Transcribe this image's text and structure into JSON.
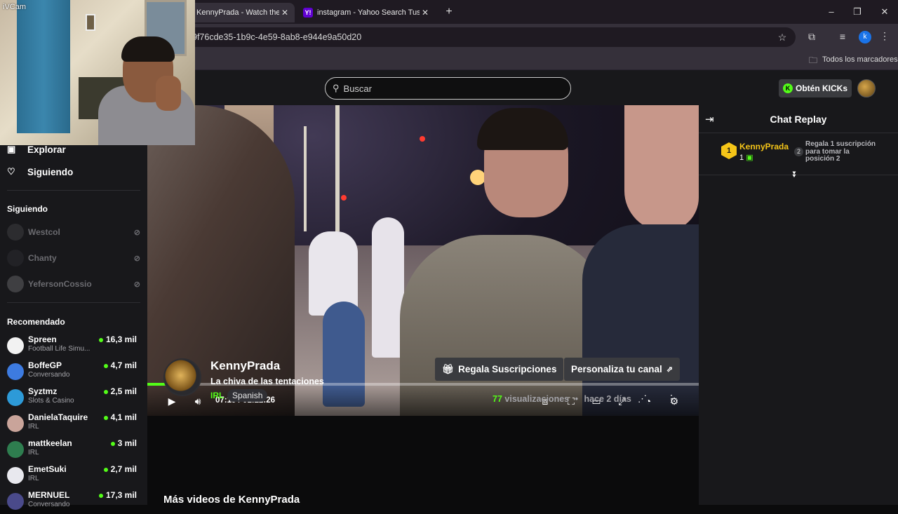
{
  "browser": {
    "tabs": [
      {
        "title": "KennyPrada - Watch the VOD on",
        "active": true,
        "favicon_color": "#53fc18"
      },
      {
        "title": "instagram - Yahoo Search Tus re",
        "active": false,
        "favicon_color": "#6001d2",
        "favicon_text": "Y!"
      }
    ],
    "new_tab_glyph": "+",
    "close_glyph": "✕",
    "url": "9f76cde35-1b9c-4e59-8ab8-e944e9a50d20",
    "bookmarks_label": "Todos los marcadores",
    "profile_letter": "k"
  },
  "webcam": {
    "watermark": "iVCam"
  },
  "site": {
    "search_placeholder": "Buscar",
    "kicks_button": "Obtén KICKs",
    "nav": {
      "explore": "Explorar",
      "following": "Siguiendo"
    },
    "following_section": {
      "title": "Siguiendo",
      "channels": [
        "Westcol",
        "Chanty",
        "YefersonCossio"
      ]
    },
    "recommended_section": {
      "title": "Recomendado",
      "channels": [
        {
          "name": "Spreen",
          "category": "Football Life Simu...",
          "viewers": "16,3 mil",
          "avatar_color": "#f2f2f2"
        },
        {
          "name": "BoffeGP",
          "category": "Conversando",
          "viewers": "4,7 mil",
          "avatar_color": "#3d7be0"
        },
        {
          "name": "Syztmz",
          "category": "Slots & Casino",
          "viewers": "2,5 mil",
          "avatar_color": "#2d9ad8"
        },
        {
          "name": "DanielaTaquire",
          "category": "IRL",
          "viewers": "4,1 mil",
          "avatar_color": "#c9a49a"
        },
        {
          "name": "mattkeelan",
          "category": "IRL",
          "viewers": "3 mil",
          "avatar_color": "#2e7d4f"
        },
        {
          "name": "EmetSuki",
          "category": "IRL",
          "viewers": "2,7 mil",
          "avatar_color": "#e8e8ee"
        },
        {
          "name": "MERNUEL",
          "category": "Conversando",
          "viewers": "17,3 mil",
          "avatar_color": "#4a4a8a"
        }
      ]
    },
    "player": {
      "current_time": "07:19",
      "duration": "01:22:26",
      "progress_fraction": 0.0887
    },
    "chat": {
      "title": "Chat Replay",
      "gifter": {
        "rank": "1",
        "name": "KennyPrada",
        "count": "1",
        "rank2": "2",
        "cta": "Regala 1 suscripción para tomar la posición 2"
      }
    },
    "channel": {
      "name": "KennyPrada",
      "title": "La chiva de las tentaciones",
      "category": "IRL",
      "language": "Spanish",
      "gift_button": "Regala Suscripciones",
      "customize_button": "Personaliza tu canal",
      "views_count": "77",
      "views_label": "visualizaciones",
      "bullet": "•",
      "age": "hace 2 días",
      "more_videos": "Más videos de KennyPrada"
    }
  },
  "colors": {
    "accent": "#53fc18",
    "panel": "#18181b",
    "button": "#3a3b3f"
  }
}
